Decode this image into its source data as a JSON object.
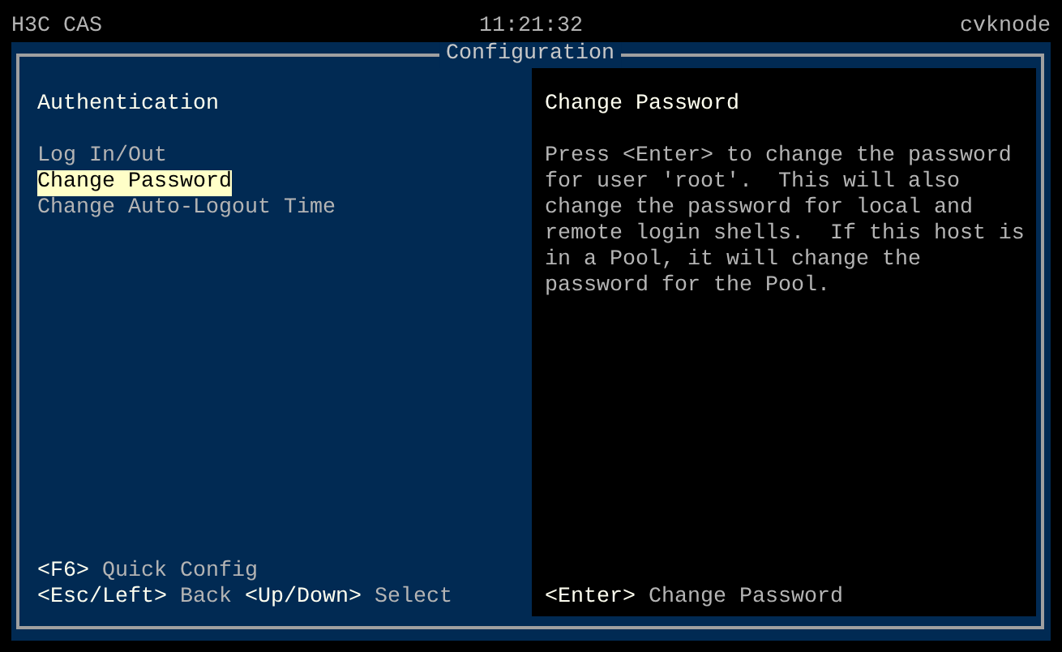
{
  "top_bar": {
    "product": "H3C CAS",
    "time": "11:21:32",
    "hostname": "cvknode"
  },
  "window": {
    "title": "Configuration"
  },
  "menu": {
    "heading": "Authentication",
    "items": [
      {
        "label": "Log In/Out",
        "selected": false
      },
      {
        "label": "Change Password",
        "selected": true
      },
      {
        "label": "Change Auto-Logout Time",
        "selected": false
      }
    ],
    "hint_lines": [
      {
        "hints": [
          {
            "key": "<F6>",
            "label": "Quick Config"
          }
        ]
      },
      {
        "hints": [
          {
            "key": "<Esc/Left>",
            "label": "Back"
          },
          {
            "key": "<Up/Down>",
            "label": "Select"
          }
        ]
      }
    ]
  },
  "detail": {
    "heading": "Change Password",
    "text": "Press <Enter> to change the password for user 'root'.  This will also change the password for local and remote login shells.  If this host is in a Pool, it will change the password for the Pool.",
    "hints": [
      {
        "key": "<Enter>",
        "label": "Change Password"
      }
    ]
  }
}
